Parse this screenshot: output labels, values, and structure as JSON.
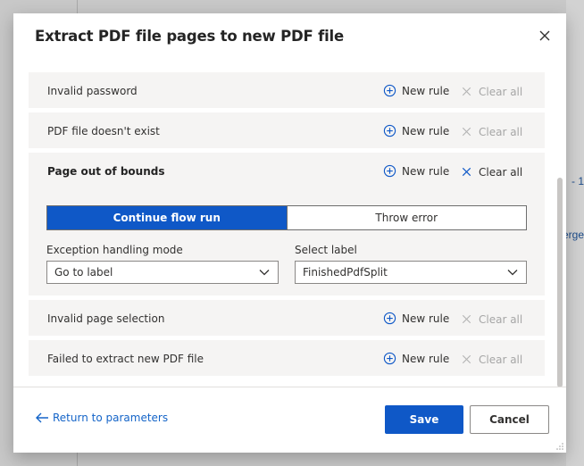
{
  "background": {
    "edge_texts": [
      "- 1",
      "erge"
    ]
  },
  "dialog": {
    "title": "Extract PDF file pages to new PDF file",
    "close_icon": "close-icon"
  },
  "rules": [
    {
      "name": "Invalid password",
      "new_rule_label": "New rule",
      "clear_all_label": "Clear all",
      "clear_all_enabled": false,
      "expanded": false
    },
    {
      "name": "PDF file doesn't exist",
      "new_rule_label": "New rule",
      "clear_all_label": "Clear all",
      "clear_all_enabled": false,
      "expanded": false
    },
    {
      "name": "Page out of bounds",
      "new_rule_label": "New rule",
      "clear_all_label": "Clear all",
      "clear_all_enabled": true,
      "expanded": true,
      "mode_toggle": {
        "options": [
          "Continue flow run",
          "Throw error"
        ],
        "selected": "Continue flow run"
      },
      "exception_mode": {
        "label": "Exception handling mode",
        "value": "Go to label"
      },
      "select_label": {
        "label": "Select label",
        "value": "FinishedPdfSplit"
      }
    },
    {
      "name": "Invalid page selection",
      "new_rule_label": "New rule",
      "clear_all_label": "Clear all",
      "clear_all_enabled": false,
      "expanded": false
    },
    {
      "name": "Failed to extract new PDF file",
      "new_rule_label": "New rule",
      "clear_all_label": "Clear all",
      "clear_all_enabled": false,
      "expanded": false
    }
  ],
  "footer": {
    "return_link": "Return to parameters",
    "save_label": "Save",
    "cancel_label": "Cancel"
  },
  "colors": {
    "accent": "#0f58c7",
    "link": "#1464c8",
    "disabled": "#a6a6a6",
    "row_bg": "#f5f4f3"
  },
  "icons": {
    "new_rule": "plus-circle-icon",
    "clear_all": "close-icon",
    "dropdown": "chevron-down-icon",
    "return": "arrow-left-icon"
  }
}
